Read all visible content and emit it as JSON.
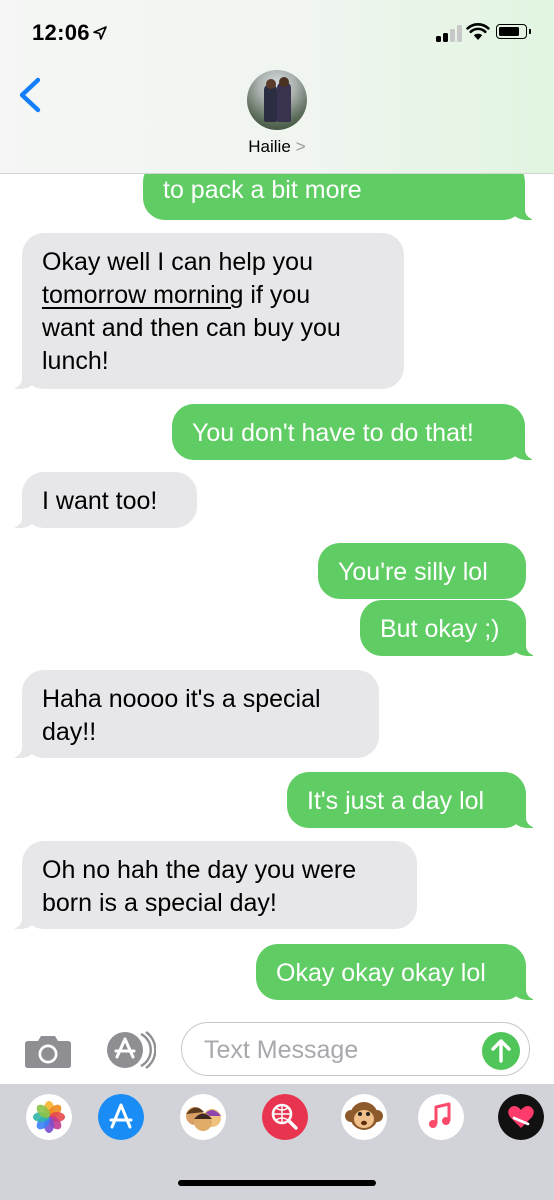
{
  "status_bar": {
    "time": "12:06"
  },
  "header": {
    "contact_name": "Hailie",
    "chevron": ">"
  },
  "messages": [
    {
      "direction": "outgoing",
      "text": "to pack a bit more"
    },
    {
      "direction": "incoming",
      "lines": [
        "Okay well I can help you",
        "tomorrow morning",
        " if you",
        "want and then can buy you",
        "lunch!"
      ]
    },
    {
      "direction": "outgoing",
      "text": "You don't have to do that!"
    },
    {
      "direction": "incoming",
      "text": "I want too!"
    },
    {
      "direction": "outgoing",
      "text": "You're silly lol"
    },
    {
      "direction": "outgoing",
      "text": "But okay ;)"
    },
    {
      "direction": "incoming",
      "lines": [
        "Haha noooo it's a special",
        "day!!"
      ]
    },
    {
      "direction": "outgoing",
      "text": "It's just a day lol"
    },
    {
      "direction": "incoming",
      "lines": [
        "Oh no hah the day you were",
        "born is a special day!"
      ]
    },
    {
      "direction": "outgoing",
      "text": "Okay okay okay lol"
    }
  ],
  "compose": {
    "placeholder": "Text Message",
    "value": ""
  },
  "app_drawer": [
    "photos",
    "app-store",
    "memoji",
    "web-images",
    "animoji",
    "music",
    "digital-touch"
  ],
  "colors": {
    "outgoing": "#5fcd64",
    "incoming": "#e7e7ea",
    "accent": "#147efb",
    "send": "#4fc55a"
  }
}
